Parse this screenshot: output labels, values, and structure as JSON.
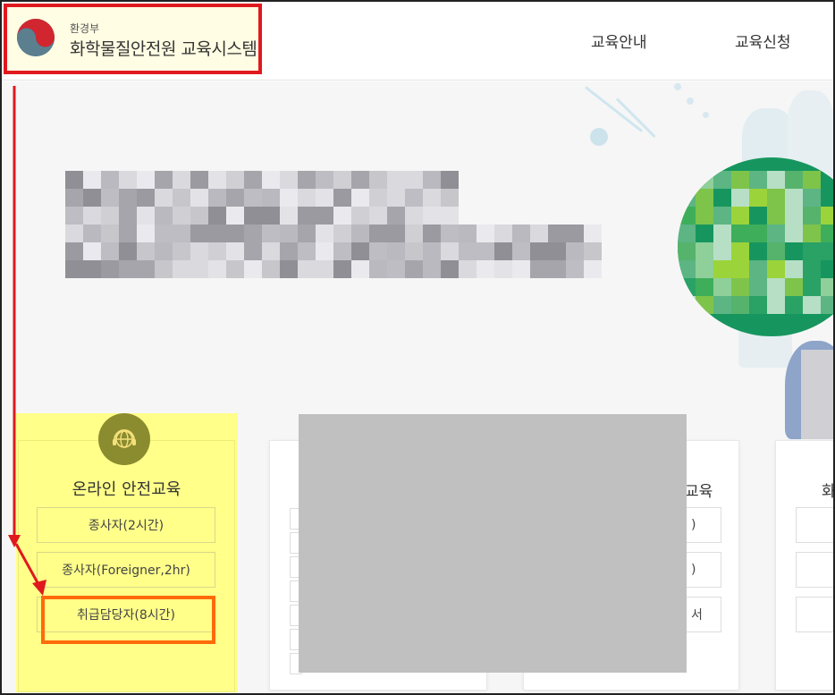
{
  "header": {
    "ministry": "환경부",
    "site_name": "화학물질안전원 교육시스템",
    "nav": [
      {
        "label": "교육안내"
      },
      {
        "label": "교육신청"
      }
    ]
  },
  "cards": {
    "online": {
      "title": "온라인 안전교육",
      "icon": "globe-headset-icon",
      "options": [
        {
          "label": "종사자(2시간)"
        },
        {
          "label": "종사자(Foreigner,2hr)"
        },
        {
          "label": "취급담당자(8시간)"
        }
      ]
    },
    "card3": {
      "title_fragment": "교육",
      "option_fragments": [
        ")",
        ")",
        "서"
      ]
    },
    "card4": {
      "title_fragment": "화"
    }
  },
  "colors": {
    "highlight_yellow": "#ffff8a",
    "annotation_red": "#e0191f",
    "annotation_orange": "#ff6b0a",
    "brand_green": "#16965e",
    "card_icon": "#8b8c2f"
  }
}
